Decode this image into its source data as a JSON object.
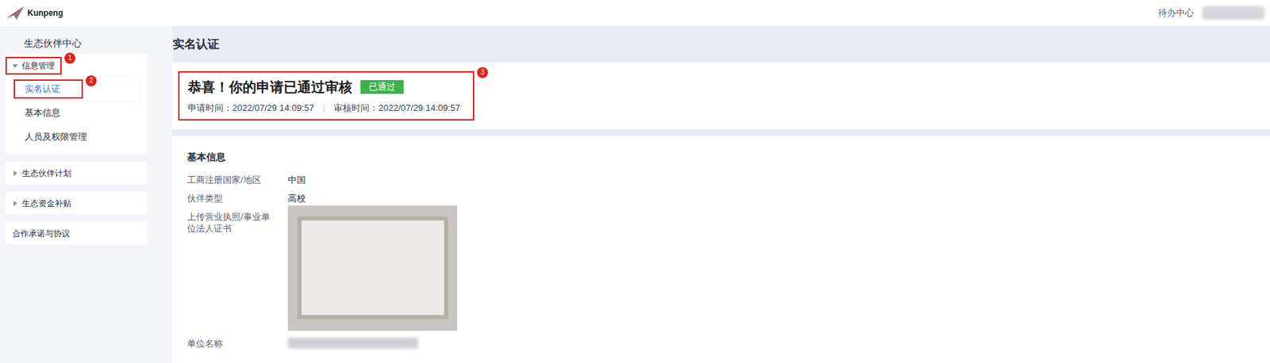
{
  "topbar": {
    "logo": "Kunpeng",
    "todo": "待办中心"
  },
  "sidebar": {
    "title": "生态伙伴中心",
    "groups": [
      {
        "label": "信息管理",
        "kind": "group",
        "expanded": true,
        "mark": "1",
        "items": [
          {
            "label": "实名认证",
            "selected": true,
            "mark": "2"
          },
          {
            "label": "基本信息",
            "selected": false,
            "mark": ""
          },
          {
            "label": "人员及权限管理",
            "selected": false,
            "mark": ""
          }
        ]
      },
      {
        "label": "生态伙伴计划",
        "kind": "group",
        "expanded": false,
        "mark": "",
        "items": []
      },
      {
        "label": "生态资金补贴",
        "kind": "group",
        "expanded": false,
        "mark": "",
        "items": []
      },
      {
        "label": "合作承诺与协议",
        "kind": "link",
        "expanded": false,
        "mark": "",
        "items": []
      }
    ]
  },
  "page": {
    "title": "实名认证"
  },
  "status": {
    "heading": "恭喜！你的申请已通过审核",
    "badge": "已通过",
    "applied": "申请时间：2022/07/29 14:09:57",
    "reviewed": "审核时间：2022/07/29 14:09:57",
    "mark": "3"
  },
  "info": {
    "title": "基本信息",
    "fields": [
      {
        "label": "工商注册国家/地区",
        "value": "中国",
        "kind": "text"
      },
      {
        "label": "伙伴类型",
        "value": "高校",
        "kind": "text"
      },
      {
        "label": "上传营业执照/事业单位法人证书",
        "value": "",
        "kind": "image"
      },
      {
        "label": "单位名称",
        "value": "",
        "kind": "blurred"
      }
    ]
  }
}
